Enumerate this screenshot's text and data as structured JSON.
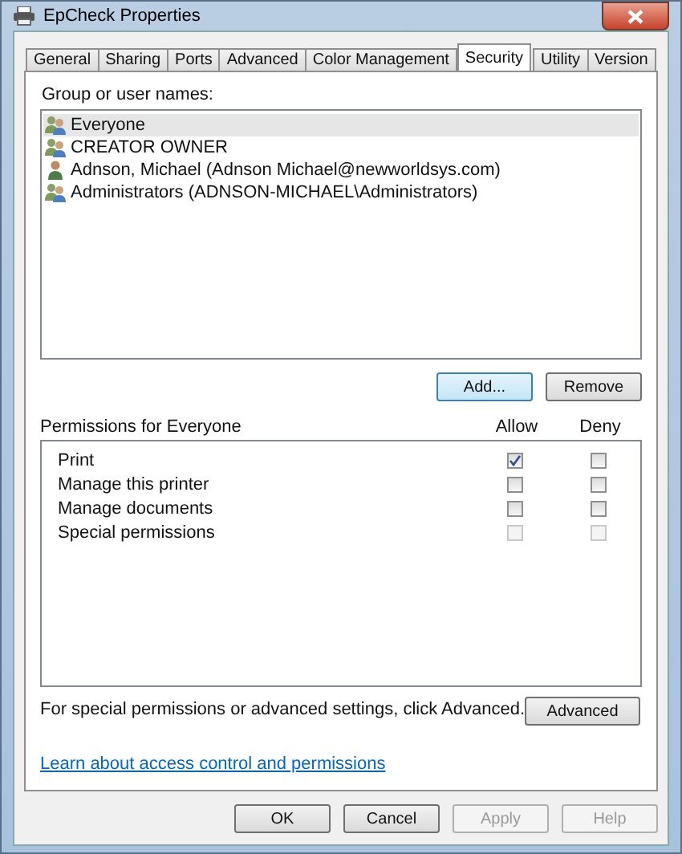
{
  "window": {
    "title": "EpCheck Properties"
  },
  "tabs": [
    {
      "label": "General",
      "selected": false
    },
    {
      "label": "Sharing",
      "selected": false
    },
    {
      "label": "Ports",
      "selected": false
    },
    {
      "label": "Advanced",
      "selected": false
    },
    {
      "label": "Color Management",
      "selected": false
    },
    {
      "label": "Security",
      "selected": true
    },
    {
      "label": "Utility",
      "selected": false
    },
    {
      "label": "Version",
      "selected": false
    }
  ],
  "users": {
    "label": "Group or user names:",
    "items": [
      {
        "name": "Everyone",
        "kind": "group",
        "selected": true
      },
      {
        "name": "CREATOR OWNER",
        "kind": "group",
        "selected": false
      },
      {
        "name": "Adnson, Michael (Adnson Michael@newworldsys.com)",
        "kind": "user",
        "selected": false
      },
      {
        "name": "Administrators (ADNSON-MICHAEL\\Administrators)",
        "kind": "group",
        "selected": false
      }
    ],
    "buttons": [
      {
        "label": "Add...",
        "focused": true
      },
      {
        "label": "Remove",
        "focused": false
      }
    ]
  },
  "permissions": {
    "label": "Permissions for Everyone",
    "columns": [
      "Allow",
      "Deny"
    ],
    "rows": [
      {
        "name": "Print",
        "allow": true,
        "deny": false,
        "disabled": false
      },
      {
        "name": "Manage this printer",
        "allow": false,
        "deny": false,
        "disabled": false
      },
      {
        "name": "Manage documents",
        "allow": false,
        "deny": false,
        "disabled": false
      },
      {
        "name": "Special permissions",
        "allow": false,
        "deny": false,
        "disabled": true
      }
    ]
  },
  "advanced_note": "For special permissions or advanced settings, click Advanced.",
  "advanced_button": "Advanced",
  "help_link": "Learn about access control and permissions",
  "footer_buttons": [
    {
      "label": "OK",
      "disabled": false
    },
    {
      "label": "Cancel",
      "disabled": false
    },
    {
      "label": "Apply",
      "disabled": true
    },
    {
      "label": "Help",
      "disabled": true
    }
  ]
}
